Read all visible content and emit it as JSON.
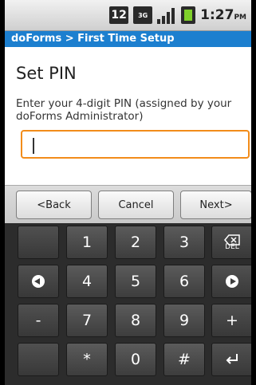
{
  "status_bar": {
    "notification_count": "12",
    "network": "3G",
    "time": "1:27",
    "ampm": "PM"
  },
  "app_bar": {
    "title": "doForms > First Time Setup"
  },
  "form": {
    "heading": "Set PIN",
    "instruction": "Enter your 4-digit PIN (assigned by your doForms Administrator)",
    "pin_value": "",
    "accent_color": "#f28c1a"
  },
  "actions": {
    "back": "<Back",
    "cancel": "Cancel",
    "next": "Next>"
  },
  "keyboard": {
    "rows": [
      [
        "",
        "1",
        "2",
        "3",
        "DEL"
      ],
      [
        "",
        "4",
        "5",
        "6",
        ""
      ],
      [
        "-",
        "7",
        "8",
        "9",
        "+"
      ],
      [
        "",
        "*",
        "0",
        "#",
        ""
      ]
    ],
    "del_label": "DEL"
  }
}
